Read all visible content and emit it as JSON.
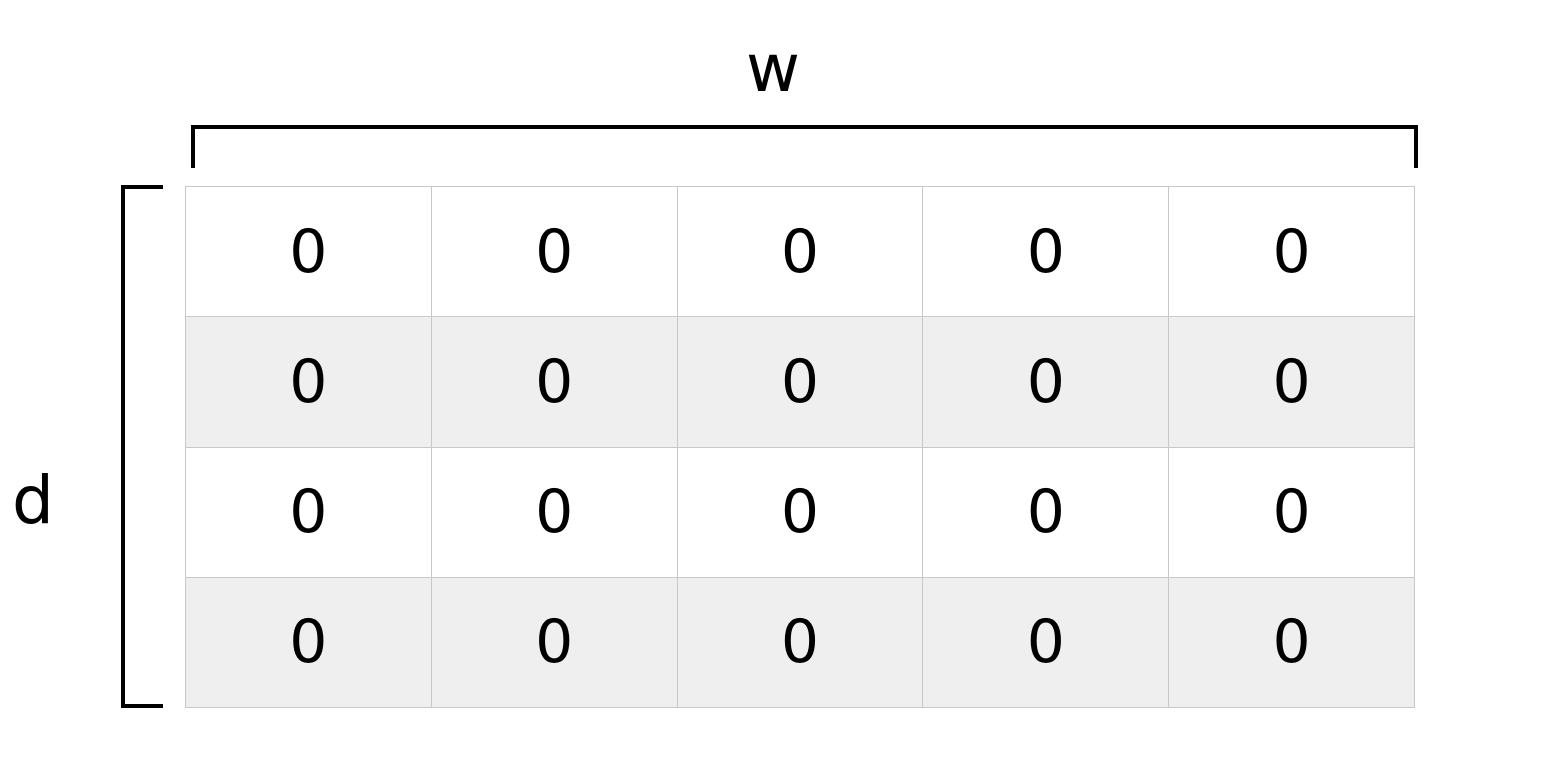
{
  "diagram": {
    "width_label": "w",
    "depth_label": "d",
    "colors": {
      "line": "#000000",
      "cell_border": "#c8c8c8",
      "row_shade": "#efefef",
      "row_plain": "#ffffff"
    },
    "rows": [
      [
        "0",
        "0",
        "0",
        "0",
        "0"
      ],
      [
        "0",
        "0",
        "0",
        "0",
        "0"
      ],
      [
        "0",
        "0",
        "0",
        "0",
        "0"
      ],
      [
        "0",
        "0",
        "0",
        "0",
        "0"
      ]
    ]
  }
}
